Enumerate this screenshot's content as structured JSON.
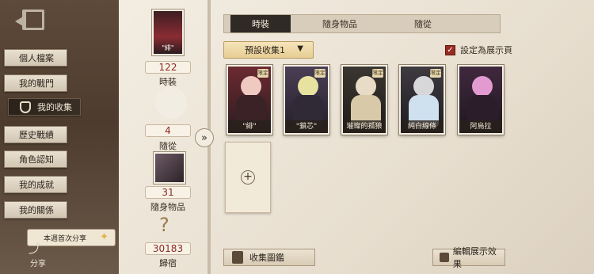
{
  "sidebar": {
    "items": [
      {
        "label": "個人檔案"
      },
      {
        "label": "我的戰門"
      },
      {
        "label": "我的收集"
      },
      {
        "label": "歷史戰績"
      },
      {
        "label": "角色認知"
      },
      {
        "label": "我的成就"
      },
      {
        "label": "我的關係"
      }
    ],
    "share_banner": "本週首次分享",
    "share_label": "分享"
  },
  "stats": [
    {
      "value": "122",
      "label": "時裝",
      "caption": "\"緋\""
    },
    {
      "value": "4",
      "label": "隨從"
    },
    {
      "value": "31",
      "label": "隨身物品"
    },
    {
      "value": "30183",
      "label": "歸宿"
    }
  ],
  "tabs": [
    {
      "label": "時裝",
      "active": true
    },
    {
      "label": "隨身物品",
      "active": false
    },
    {
      "label": "隨從",
      "active": false
    }
  ],
  "preset": {
    "label": "預設收集1"
  },
  "showcase": {
    "label": "設定為展示頁",
    "checked": true
  },
  "cards": [
    {
      "name": "\"緋\"",
      "badge": "限定"
    },
    {
      "name": "\"鎖芯\"",
      "badge": "限定"
    },
    {
      "name": "璀璨的孤狼",
      "badge": "限定"
    },
    {
      "name": "純白線條",
      "badge": "限定"
    },
    {
      "name": "阿烏拉",
      "badge": ""
    }
  ],
  "buttons": {
    "collection_book": "收集圖鑑",
    "edit_showcase": "編輯展示效果"
  },
  "arrow": "»",
  "add": "+",
  "colors": {
    "accent": "#9a2b22",
    "tab_active": "#2f2a25"
  }
}
